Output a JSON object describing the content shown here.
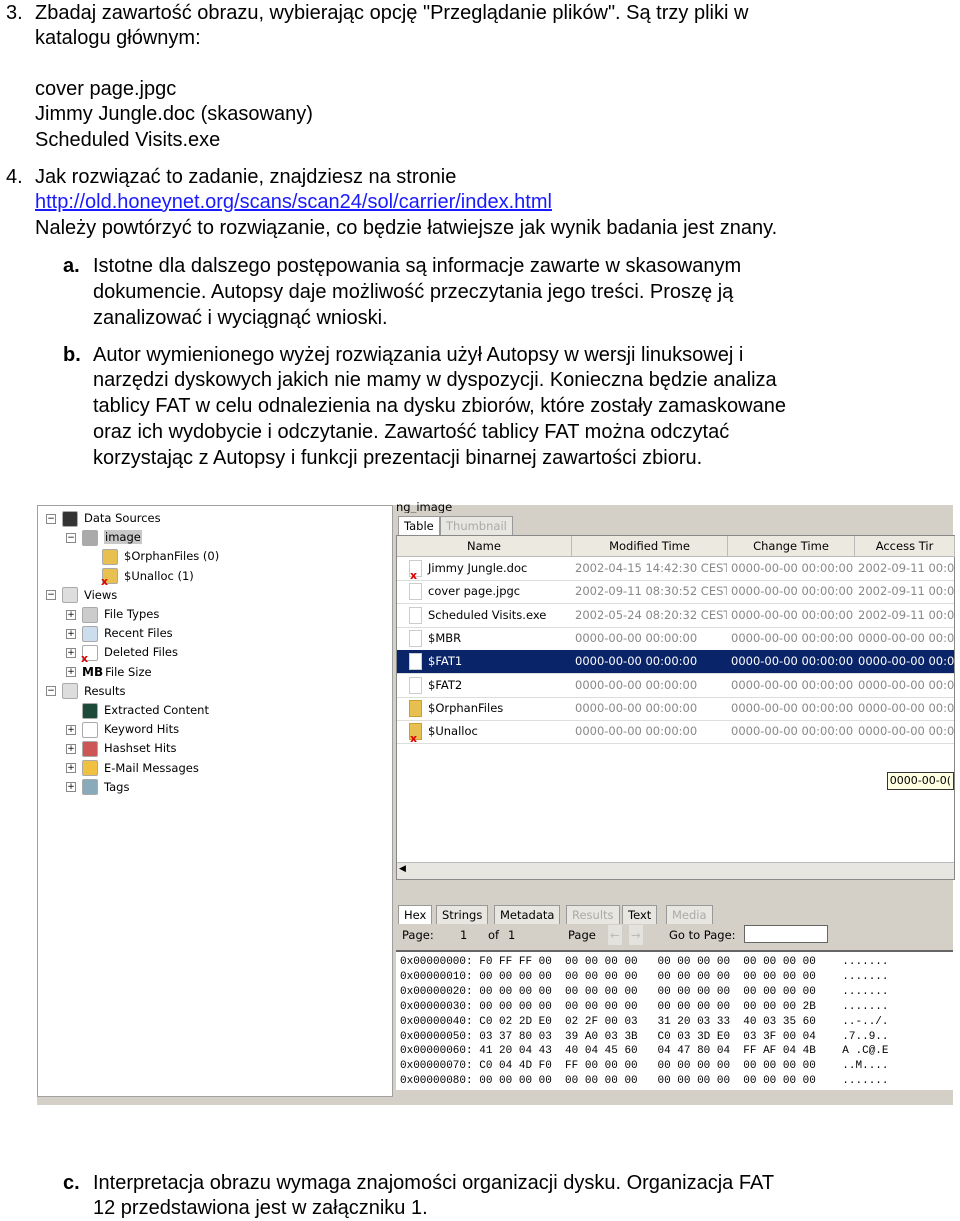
{
  "doc": {
    "item3": {
      "num": "3.",
      "line1": "Zbadaj zawartość obrazu, wybierając opcję \"Przeglądanie plików\". Są trzy pliki w",
      "line2": "katalogu głównym:",
      "files": [
        "cover page.jpgc",
        "Jimmy Jungle.doc (skasowany)",
        "Scheduled Visits.exe"
      ]
    },
    "item4": {
      "num": "4.",
      "line1": "Jak rozwiązać to zadanie, znajdziesz na stronie",
      "link": "http://old.honeynet.org/scans/scan24/sol/carrier/index.html",
      "line3": "Należy powtórzyć to rozwiązanie, co będzie łatwiejsze jak  wynik badania jest znany."
    },
    "a": {
      "label": "a.",
      "lines": [
        "Istotne dla dalszego postępowania są informacje zawarte w skasowanym",
        "dokumencie. Autopsy daje możliwość przeczytania jego treści. Proszę ją",
        "zanalizować i wyciągnąć wnioski."
      ]
    },
    "b": {
      "label": "b.",
      "lines": [
        "Autor wymienionego wyżej rozwiązania użył Autopsy w wersji linuksowej i",
        "narzędzi dyskowych jakich nie mamy w dyspozycji. Konieczna będzie analiza",
        "tablicy FAT w celu odnalezienia na dysku zbiorów, które zostały zamaskowane",
        "oraz ich wydobycie i odczytanie. Zawartość tablicy FAT można odczytać",
        "korzystając z Autopsy i funkcji prezentacji binarnej zawartości zbioru."
      ]
    },
    "c": {
      "label": "c.",
      "lines": [
        "Interpretacja obrazu wymaga znajomości organizacji dysku. Organizacja FAT",
        "12 przedstawiona jest w załączniku 1."
      ]
    }
  },
  "screenshot": {
    "tree": [
      {
        "label": "Data Sources",
        "icon": "drive-icon",
        "level": 0,
        "exp": "-"
      },
      {
        "label": "image",
        "icon": "disk-image-icon",
        "level": 1,
        "exp": "-",
        "selected": true
      },
      {
        "label": "$OrphanFiles (0)",
        "icon": "folder-icon",
        "level": 2
      },
      {
        "label": "$Unalloc (1)",
        "icon": "deleted-folder-icon",
        "level": 2
      },
      {
        "label": "Views",
        "icon": "eye-icon",
        "level": 0,
        "exp": "-"
      },
      {
        "label": "File Types",
        "icon": "file-types-icon",
        "level": 1,
        "exp": "+"
      },
      {
        "label": "Recent Files",
        "icon": "clock-icon",
        "level": 1,
        "exp": "+"
      },
      {
        "label": "Deleted Files",
        "icon": "deleted-icon",
        "level": 1,
        "exp": "+"
      },
      {
        "label": "File Size",
        "icon": "mb-icon",
        "icon_text": "MB",
        "level": 1,
        "exp": "+"
      },
      {
        "label": "Results",
        "icon": "results-icon",
        "level": 0,
        "exp": "-"
      },
      {
        "label": "Extracted Content",
        "icon": "extracted-icon",
        "level": 1
      },
      {
        "label": "Keyword Hits",
        "icon": "magnifier-icon",
        "level": 1,
        "exp": "+"
      },
      {
        "label": "Hashset Hits",
        "icon": "pin-icon",
        "level": 1,
        "exp": "+"
      },
      {
        "label": "E-Mail Messages",
        "icon": "mail-icon",
        "level": 1,
        "exp": "+"
      },
      {
        "label": "Tags",
        "icon": "tag-icon",
        "level": 1,
        "exp": "+"
      }
    ],
    "title_fragment": "ng_image",
    "table_tabs": [
      "Table",
      "Thumbnail"
    ],
    "columns": [
      "Name",
      "Modified Time",
      "Change Time",
      "Access Tir"
    ],
    "rows": [
      {
        "name": "Jimmy Jungle.doc",
        "icon": "deleted-file-icon",
        "modified": "2002-04-15 14:42:30 CEST",
        "change": "0000-00-00 00:00:00",
        "access": "2002-09-11 00:00:"
      },
      {
        "name": "cover page.jpgc",
        "icon": "file-icon",
        "modified": "2002-09-11 08:30:52 CEST",
        "change": "0000-00-00 00:00:00",
        "access": "2002-09-11 00:00:"
      },
      {
        "name": "Scheduled Visits.exe",
        "icon": "file-icon",
        "modified": "2002-05-24 08:20:32 CEST",
        "change": "0000-00-00 00:00:00",
        "access": "2002-09-11 00:00:"
      },
      {
        "name": "$MBR",
        "icon": "file-icon",
        "modified": "0000-00-00 00:00:00",
        "change": "0000-00-00 00:00:00",
        "access": "0000-00-00 00:00:"
      },
      {
        "name": "$FAT1",
        "icon": "file-icon",
        "modified": "0000-00-00 00:00:00",
        "change": "0000-00-00 00:00:00",
        "access": "0000-00-00 00:00:",
        "selected": true
      },
      {
        "name": "$FAT2",
        "icon": "file-icon",
        "modified": "0000-00-00 00:00:00",
        "change": "0000-00-00 00:00:00",
        "access": "0000-00-00 00:00:"
      },
      {
        "name": "$OrphanFiles",
        "icon": "folder-icon",
        "modified": "0000-00-00 00:00:00",
        "change": "0000-00-00 00:00:00",
        "access": "0000-00-00 00:00:"
      },
      {
        "name": "$Unalloc",
        "icon": "deleted-folder-icon",
        "modified": "0000-00-00 00:00:00",
        "change": "0000-00-00 00:00:00",
        "access": "0000-00-00 00:00:"
      }
    ],
    "tooltip": "0000-00-0(",
    "viewer_tabs": [
      {
        "label": "Hex"
      },
      {
        "label": "Strings"
      },
      {
        "label": "Metadata"
      },
      {
        "label": "Results",
        "disabled": true
      },
      {
        "label": "Text"
      },
      {
        "label": "Media",
        "disabled": true
      }
    ],
    "pager": {
      "page_label": "Page:",
      "page": "1",
      "of": "of",
      "total": "1",
      "page_nav_label": "Page",
      "goto_label": "Go to Page:",
      "goto_value": ""
    },
    "hex": [
      {
        "off": "0x00000000:",
        "bytes": "F0 FF FF 00  00 00 00 00   00 00 00 00  00 00 00 00",
        "ascii": "......."
      },
      {
        "off": "0x00000010:",
        "bytes": "00 00 00 00  00 00 00 00   00 00 00 00  00 00 00 00",
        "ascii": "......."
      },
      {
        "off": "0x00000020:",
        "bytes": "00 00 00 00  00 00 00 00   00 00 00 00  00 00 00 00",
        "ascii": "......."
      },
      {
        "off": "0x00000030:",
        "bytes": "00 00 00 00  00 00 00 00   00 00 00 00  00 00 00 2B",
        "ascii": "......."
      },
      {
        "off": "0x00000040:",
        "bytes": "C0 02 2D E0  02 2F 00 03   31 20 03 33  40 03 35 60",
        "ascii": "..-../."
      },
      {
        "off": "0x00000050:",
        "bytes": "03 37 80 03  39 A0 03 3B   C0 03 3D E0  03 3F 00 04",
        "ascii": ".7..9.."
      },
      {
        "off": "0x00000060:",
        "bytes": "41 20 04 43  40 04 45 60   04 47 80 04  FF AF 04 4B",
        "ascii": "A .C@.E"
      },
      {
        "off": "0x00000070:",
        "bytes": "C0 04 4D F0  FF 00 00 00   00 00 00 00  00 00 00 00",
        "ascii": "..M...."
      },
      {
        "off": "0x00000080:",
        "bytes": "00 00 00 00  00 00 00 00   00 00 00 00  00 00 00 00",
        "ascii": "......."
      }
    ]
  }
}
